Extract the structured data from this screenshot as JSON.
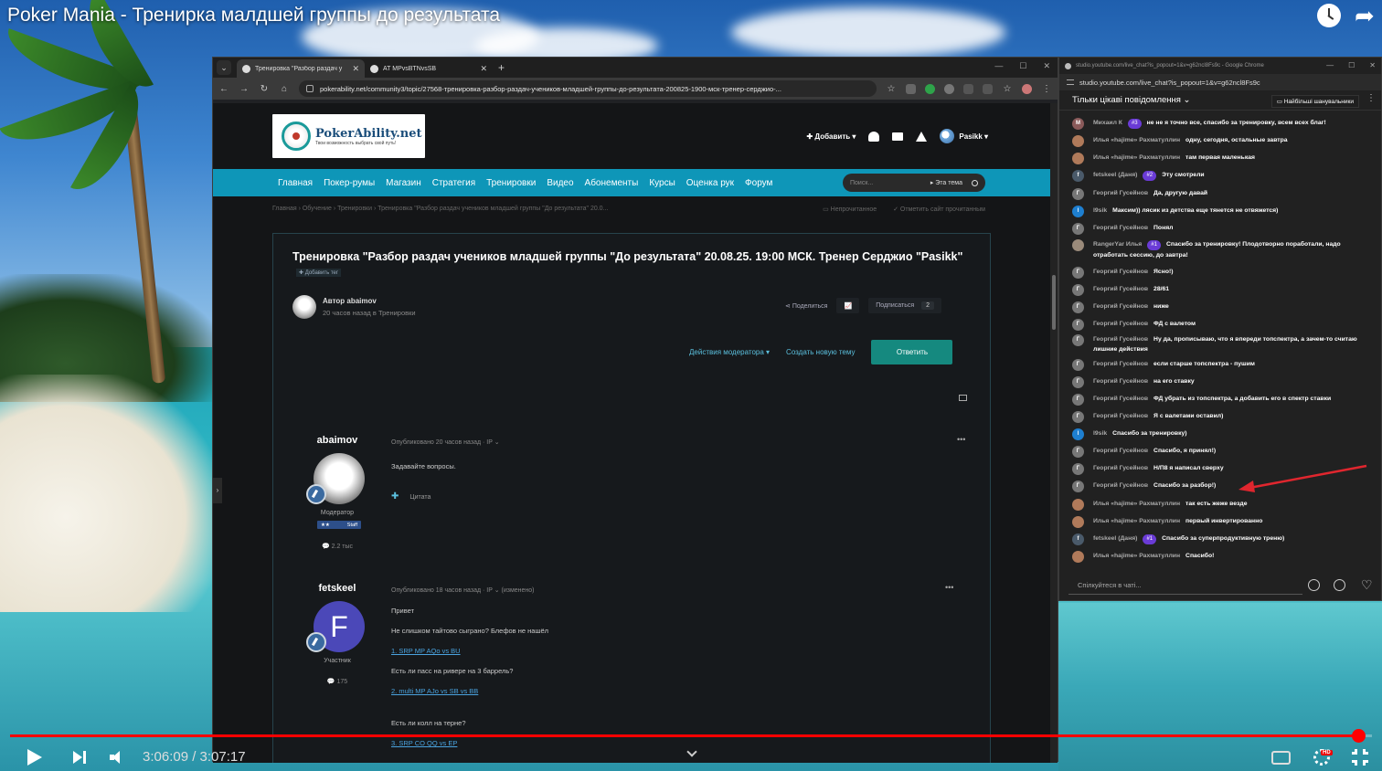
{
  "video": {
    "title": "Poker Mania - Тренирка малдшей группы до результата",
    "current_time": "3:06:09",
    "duration": "3:07:17",
    "time_display": "3:06:09 / 3:07:17",
    "progress": 0.99,
    "hd_badge": "HD"
  },
  "browser1": {
    "tabs": [
      {
        "title": "Тренировка \"Разбор раздач у"
      },
      {
        "title": "AT MPvsBTNvsSB"
      }
    ],
    "url": "pokerability.net/community3/topic/27568-тренировка-разбор-раздач-учеников-младшей-группы-до-результата-200825-1900-мск-тренер-серджио-..."
  },
  "site": {
    "logo_main": "PokerAbility.net",
    "logo_sub": "Твои возможность выбрать свой путь!",
    "add_label": "✚ Добавить ▾",
    "username": "Pasikk ▾",
    "nav": [
      "Главная",
      "Покер-румы",
      "Магазин",
      "Стратегия",
      "Тренировки",
      "Видео",
      "Абонементы",
      "Курсы",
      "Оценка рук",
      "Форум"
    ],
    "search_placeholder": "Поиск...",
    "search_scope": "▸ Эта тема",
    "breadcrumb": "Главная  ›  Обучение  ›  Тренировки  ›  Тренировка \"Разбор раздач учеников младшей группы \"До результата\" 20.0...",
    "unread": "Непрочитанное",
    "mark_read": "Отметить сайт прочитанным"
  },
  "topic": {
    "title": "Тренировка \"Разбор раздач учеников младшей группы \"До результата\" 20.08.25. 19:00 МСК. Тренер Серджио \"Pasikk\"",
    "add_tag": "✚ Добавить тег",
    "author_label": "Автор abaimov",
    "author_meta": "20 часов назад в Тренировки",
    "share": "Поделиться",
    "subscribe": "Подписаться",
    "subscribe_count": "2",
    "moderator_actions": "Действия модератора ▾",
    "new_topic": "Создать новую тему",
    "reply": "Ответить"
  },
  "posts": [
    {
      "username": "abaimov",
      "role": "Модератор",
      "staff_stars": "★★",
      "staff_label": "Staff",
      "count": "2.2 тыс",
      "meta": "Опубликовано 20 часов назад · IP ⌄",
      "lines": [
        "Задавайте вопросы."
      ],
      "quote": "Цитата"
    },
    {
      "username": "fetskeel",
      "avatar_letter": "F",
      "role": "Участник",
      "count": "175",
      "meta": "Опубликовано 18 часов назад · IP ⌄ (изменено)",
      "lines": [
        "Привет",
        "Не слишком тайтово сыграно? Блефов не нашёл",
        "1. SRP MP AQo vs BU",
        "Есть ли пасс на ривере на 3 баррель?",
        "2. multi MP AJo vs SB vs BB",
        "Есть ли колл на терне?",
        "3. SRP CO QQ vs EP"
      ]
    }
  ],
  "chat_window": {
    "title": "studio.youtube.com/live_chat?is_popout=1&v=g62ncl8Fs9c - Google Chrome",
    "url": "studio.youtube.com/live_chat?is_popout=1&v=g62ncl8Fs9c",
    "header": "Тільки цікаві повідомлення ⌄",
    "filter": "Найбільші шанувальники",
    "input_placeholder": "Спілкуйтеся в чаті...",
    "messages": [
      {
        "author": "Михаил К",
        "badge": "#3",
        "text": "не не я точно все, спасибо за тренировку, всем всех благ!",
        "avatar": "M",
        "color": "#8a5a5a"
      },
      {
        "author": "Илья «hajime» Рахматуллин",
        "badge": "",
        "text": "одну, сегодня, остальные завтра",
        "avatar": "",
        "color": "#b07a5a"
      },
      {
        "author": "Илья «hajime» Рахматуллин",
        "badge": "",
        "text": "там первая маленькая",
        "avatar": "",
        "color": "#b07a5a"
      },
      {
        "author": "fetskeel (Даня)",
        "badge": "#2",
        "text": "Эту смотрели",
        "avatar": "f",
        "color": "#4a5a6a"
      },
      {
        "author": "Георгий Гусейнов",
        "badge": "",
        "text": "Да, другую давай",
        "avatar": "Г",
        "color": "#777"
      },
      {
        "author": "l9sik",
        "badge": "",
        "text": "Максим)) лясик из детства еще тянется не отвяжется)",
        "avatar": "l",
        "color": "#1e7fd0"
      },
      {
        "author": "Георгий Гусейнов",
        "badge": "",
        "text": "Понял",
        "avatar": "Г",
        "color": "#777"
      },
      {
        "author": "RangerYar Илья",
        "badge": "#1",
        "text": "Спасибо за тренировку! Плодотворно поработали, надо отработать сессию, до завтра!",
        "avatar": "",
        "color": "#9a8a7a"
      },
      {
        "author": "Георгий Гусейнов",
        "badge": "",
        "text": "Ясно!)",
        "avatar": "Г",
        "color": "#777"
      },
      {
        "author": "Георгий Гусейнов",
        "badge": "",
        "text": "28/61",
        "avatar": "Г",
        "color": "#777"
      },
      {
        "author": "Георгий Гусейнов",
        "badge": "",
        "text": "ниже",
        "avatar": "Г",
        "color": "#777"
      },
      {
        "author": "Георгий Гусейнов",
        "badge": "",
        "text": "ФД с валетом",
        "avatar": "Г",
        "color": "#777"
      },
      {
        "author": "Георгий Гусейнов",
        "badge": "",
        "text": "Ну да, прописываю, что я впереди топспектра, а зачем-то считаю лишние действия",
        "avatar": "Г",
        "color": "#777"
      },
      {
        "author": "Георгий Гусейнов",
        "badge": "",
        "text": "если старше топспектра - пушим",
        "avatar": "Г",
        "color": "#777"
      },
      {
        "author": "Георгий Гусейнов",
        "badge": "",
        "text": "на его ставку",
        "avatar": "Г",
        "color": "#777"
      },
      {
        "author": "Георгий Гусейнов",
        "badge": "",
        "text": "ФД убрать из топспектра, а добавить его в спектр ставки",
        "avatar": "Г",
        "color": "#777"
      },
      {
        "author": "Георгий Гусейнов",
        "badge": "",
        "text": "Я с валетами оставил)",
        "avatar": "Г",
        "color": "#777"
      },
      {
        "author": "l9sik",
        "badge": "",
        "text": "Спасибо за тренировку)",
        "avatar": "l",
        "color": "#1e7fd0"
      },
      {
        "author": "Георгий Гусейнов",
        "badge": "",
        "text": "Спасибо, я принял!)",
        "avatar": "Г",
        "color": "#777"
      },
      {
        "author": "Георгий Гусейнов",
        "badge": "",
        "text": "Н/П8 я написал сверху",
        "avatar": "Г",
        "color": "#777"
      },
      {
        "author": "Георгий Гусейнов",
        "badge": "",
        "text": "Спасибо за разбор!)",
        "avatar": "Г",
        "color": "#777"
      },
      {
        "author": "Илья «hajime» Рахматуллин",
        "badge": "",
        "text": "так есть жеже везде",
        "avatar": "",
        "color": "#b07a5a"
      },
      {
        "author": "Илья «hajime» Рахматуллин",
        "badge": "",
        "text": "первый инвертированно",
        "avatar": "",
        "color": "#b07a5a"
      },
      {
        "author": "fetskeel (Даня)",
        "badge": "#1",
        "text": "Спасибо за суперпродуктивную треню)",
        "avatar": "f",
        "color": "#4a5a6a"
      },
      {
        "author": "Илья «hajime» Рахматуллин",
        "badge": "",
        "text": "Спасибо!",
        "avatar": "",
        "color": "#b07a5a"
      }
    ]
  },
  "colors": {
    "accent_nav": "#0e96b8",
    "reply_button": "#15897f",
    "progress": "#ff0000",
    "arrow": "#e0262e"
  }
}
